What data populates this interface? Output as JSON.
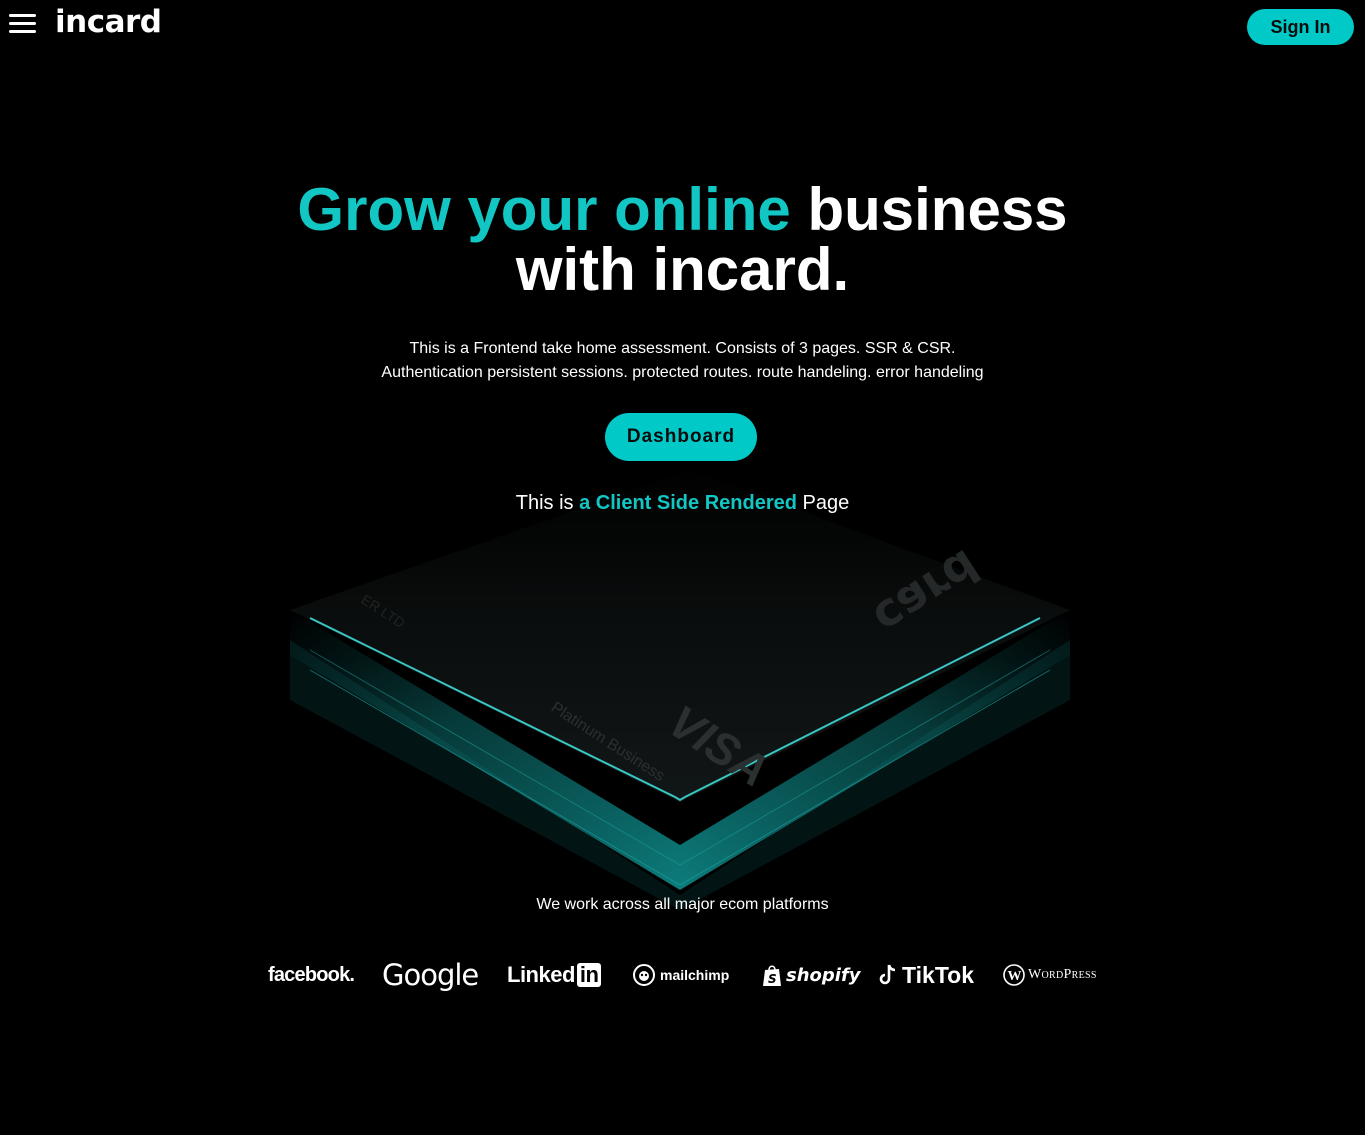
{
  "header": {
    "menu_icon": "hamburger-menu-icon",
    "logo_text": "incard",
    "signin_label": "Sign In"
  },
  "hero": {
    "title_accent": "Grow your online",
    "title_rest_line1": "business",
    "title_line2": "with incard.",
    "subtitle_line1": "This is a Frontend take home assessment. Consists of 3 pages. SSR & CSR.",
    "subtitle_line2": "Authentication persistent sessions. protected routes. route handeling. error handeling",
    "dashboard_label": "Dashboard",
    "render_prefix": "This is",
    "render_highlight": "a Client Side Rendered",
    "render_suffix": "Page"
  },
  "card": {
    "brand": "VISA",
    "tier": "Platinum Business",
    "company_fragment": "ER LTD",
    "logo_fragment": "card"
  },
  "platforms": {
    "label": "We work across all major ecom platforms",
    "logos": {
      "facebook": "facebook.",
      "google": "Google",
      "linkedin_word": "Linked",
      "linkedin_box": "in",
      "mailchimp": "mailchimp",
      "shopify": "shopify",
      "tiktok": "TikTok",
      "wordpress": "WordPress"
    }
  },
  "colors": {
    "accent": "#12c6c4",
    "button": "#00c9c8",
    "background": "#000000",
    "text": "#ffffff"
  }
}
